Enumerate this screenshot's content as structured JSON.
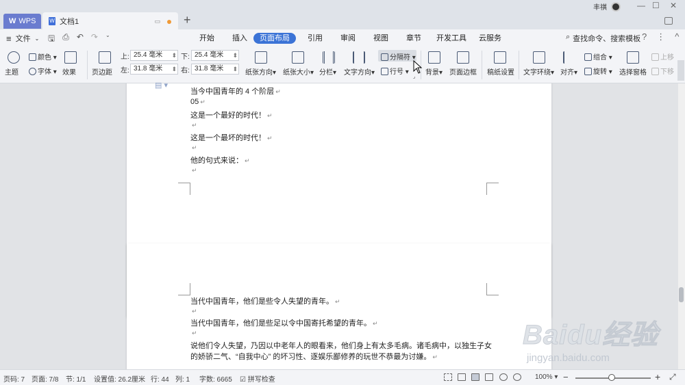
{
  "titlebar": {
    "app_tab": "WPS",
    "doc_tab": "文档1",
    "new_tab": "+",
    "user_name": "丰祺",
    "window_min": "—",
    "window_max": "☐",
    "window_close": "✕"
  },
  "menubar": {
    "file_menu": "文件",
    "tabs": [
      "开始",
      "插入",
      "页面布局",
      "引用",
      "审阅",
      "视图",
      "章节",
      "开发工具",
      "云服务"
    ],
    "active_tab": "页面布局",
    "search_label": "查找命令、搜索模板",
    "help": "?",
    "more": "⋮",
    "collapse": "^"
  },
  "toolbar": {
    "theme": "主题",
    "color": "颜色",
    "font": "字体",
    "effect": "效果",
    "margins": "页边距",
    "margin_top_label": "上:",
    "margin_top_value": "25.4 毫米",
    "margin_bottom_label": "下:",
    "margin_bottom_value": "25.4 毫米",
    "margin_left_label": "左:",
    "margin_left_value": "31.8 毫米",
    "margin_right_label": "右:",
    "margin_right_value": "31.8 毫米",
    "orientation": "纸张方向",
    "size": "纸张大小",
    "columns": "分栏",
    "text_direction": "文字方向",
    "breaks": "分隔符",
    "line_numbers": "行号",
    "background": "背景",
    "page_border": "页面边框",
    "draft_settings": "稿纸设置",
    "wrap_text": "文字环绕",
    "align": "对齐",
    "group": "组合",
    "rotate": "旋转",
    "selection_pane": "选择窗格",
    "bring_forward": "上移",
    "send_backward": "下移"
  },
  "document": {
    "page1_lines": [
      "当今中国青年的 4 个阶层",
      "05",
      "这是一个最好的时代！",
      "",
      "这是一个最坏的时代！",
      "",
      "他的句式来说：",
      ""
    ],
    "page2_lines": [
      "当代中国青年，他们是些令人失望的青年。",
      "",
      "当代中国青年，他们是些足以令中国寄托希望的青年。",
      "",
      "说他们令人失望，乃因以中老年人的眼看来，他们身上有太多毛病。诸毛病中，以独生子女",
      "的娇骄二气、“自我中心” 的坏习性、逐娱乐鄙修养的玩世不恭最为讨嫌。"
    ],
    "paragraph_mark": "↵"
  },
  "statusbar": {
    "page_code": "页码: 7",
    "page_count": "页面: 7/8",
    "section": "节: 1/1",
    "setting": "设置值: 26.2厘米",
    "row": "行: 44",
    "col": "列: 1",
    "word_count": "字数: 6665",
    "spell_check": "拼写检查",
    "zoom": "100%",
    "zoom_out": "−",
    "zoom_in": "+"
  },
  "watermark": {
    "brand": "Baidu经验",
    "url": "jingyan.baidu.com"
  },
  "colors": {
    "accent": "#3b73d6",
    "wps_tab": "#6a7ccf",
    "modified_dot": "#f09a37"
  }
}
